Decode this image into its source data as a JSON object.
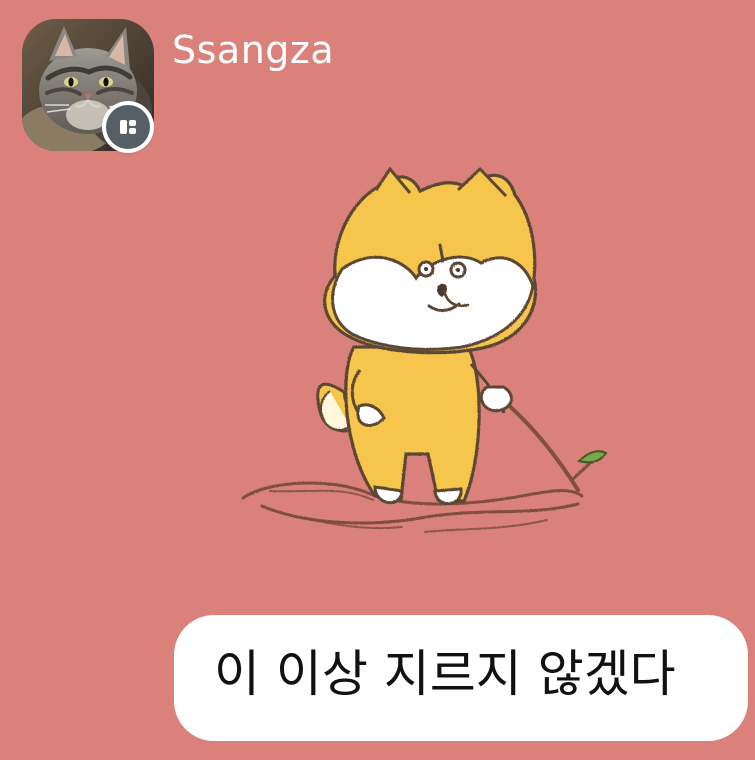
{
  "chat": {
    "background_color": "#d9817a",
    "sender": {
      "name": "Ssangza",
      "avatar_subject": "cat",
      "badge_icon": "profile-badge-icon"
    },
    "sticker": {
      "character": "yellow dog walking with a stick"
    },
    "message": {
      "text": "이 이상 지르지 않겠다"
    }
  }
}
